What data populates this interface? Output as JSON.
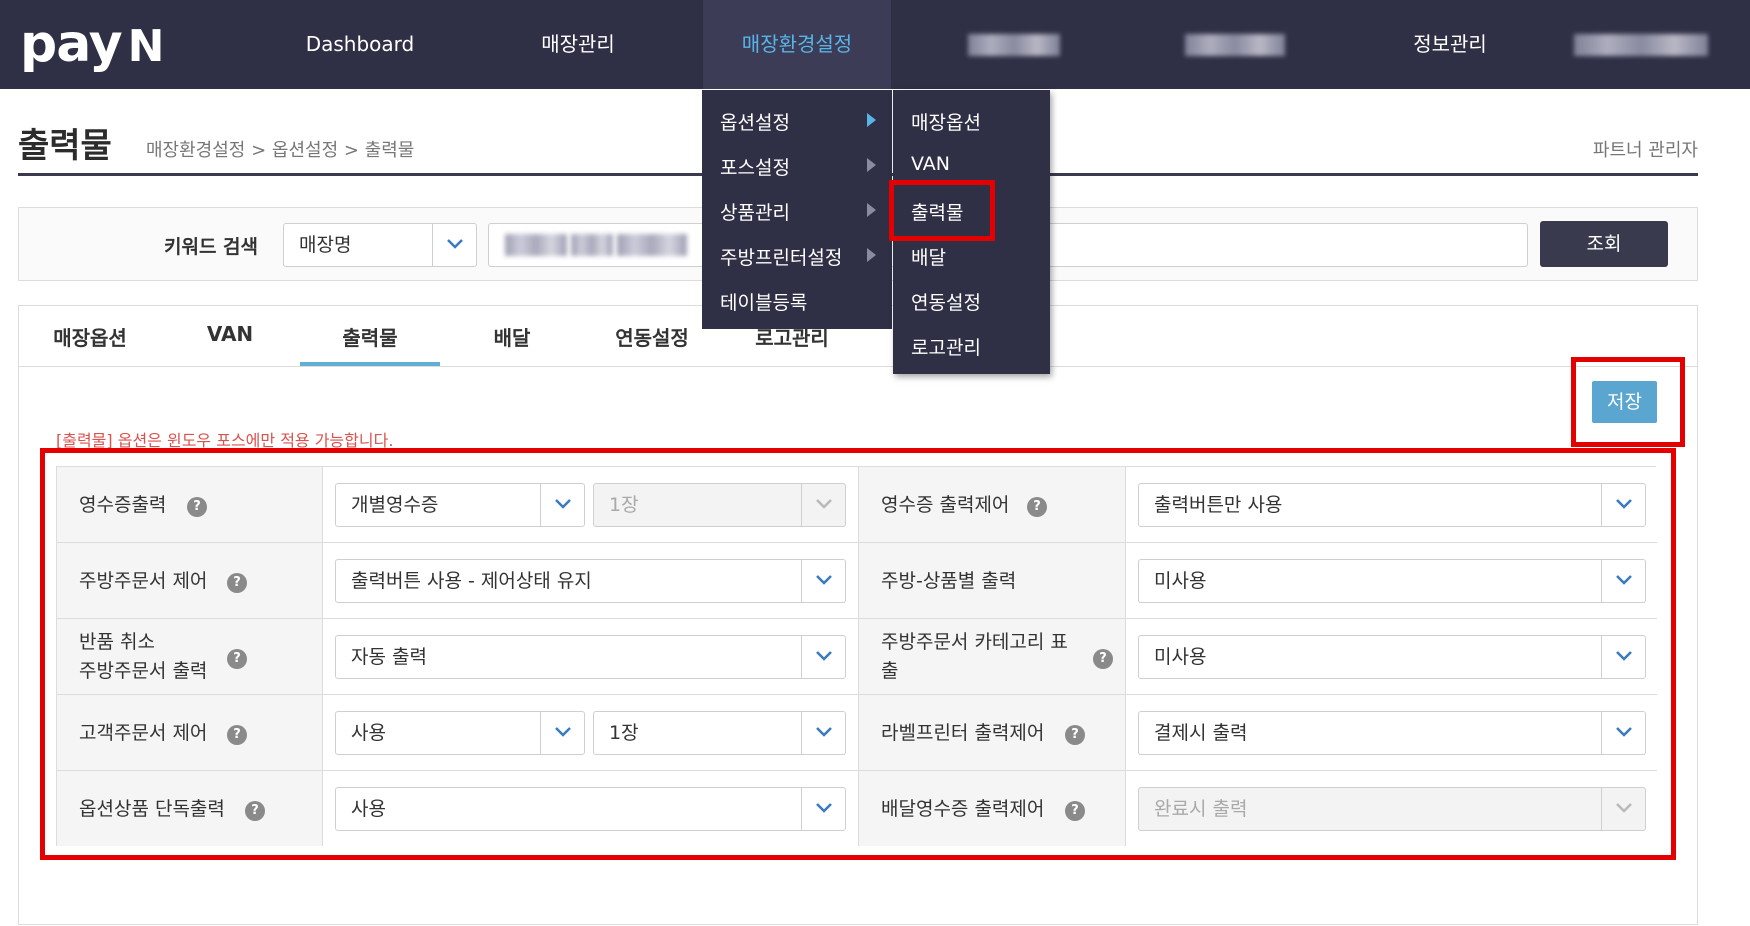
{
  "nav": {
    "logo": "pay",
    "logo_n": "N",
    "items": [
      "Dashboard",
      "매장관리",
      "매장환경설정",
      "정보관리"
    ],
    "active": "매장환경설정"
  },
  "header": {
    "title": "출력물",
    "breadcrumb": "매장환경설정 > 옵션설정 > 출력물",
    "partner": "파트너 관리자"
  },
  "search": {
    "label": "키워드 검색",
    "field_select": "매장명",
    "button": "조회"
  },
  "tabs": [
    "매장옵션",
    "VAN",
    "출력물",
    "배달",
    "연동설정",
    "로고관리"
  ],
  "active_tab": "출력물",
  "save_button": "저장",
  "notice": "[출력물] 옵션은 윈도우 포스에만 적용 가능합니다.",
  "help_glyph": "?",
  "options_left": [
    {
      "label": "영수증출력",
      "select1": "개별영수증",
      "select2": "1장",
      "select2_disabled": true
    },
    {
      "label": "주방주문서 제어",
      "select1": "출력버튼 사용 - 제어상태 유지"
    },
    {
      "label_line1": "반품 취소",
      "label_line2": "주방주문서 출력",
      "select1": "자동 출력"
    },
    {
      "label": "고객주문서 제어",
      "select1": "사용",
      "select2": "1장",
      "select2_disabled": false
    },
    {
      "label": "옵션상품 단독출력",
      "select1": "사용"
    }
  ],
  "options_right": [
    {
      "label": "영수증 출력제어",
      "select": "출력버튼만 사용",
      "disabled": false
    },
    {
      "label": "주방-상품별 출력",
      "select": "미사용",
      "disabled": false
    },
    {
      "label_line1": "주방주문서 카테고리 표",
      "label_line2": "출",
      "select": "미사용",
      "disabled": false
    },
    {
      "label": "라벨프린터 출력제어",
      "select": "결제시 출력",
      "disabled": false
    },
    {
      "label": "배달영수증 출력제어",
      "select": "완료시 출력",
      "disabled": true
    }
  ],
  "menu": {
    "level1": [
      "옵션설정",
      "포스설정",
      "상품관리",
      "주방프린터설정",
      "테이블등록"
    ],
    "level2": [
      "매장옵션",
      "VAN",
      "출력물",
      "배달",
      "연동설정",
      "로고관리"
    ]
  },
  "colors": {
    "nav_bg": "#2f2f45",
    "nav_active_text": "#58b4e6",
    "tab_accent": "#5fb0d4",
    "save_button": "#5aa6d1",
    "highlight": "#e40000",
    "notice_text": "#d9534f"
  }
}
